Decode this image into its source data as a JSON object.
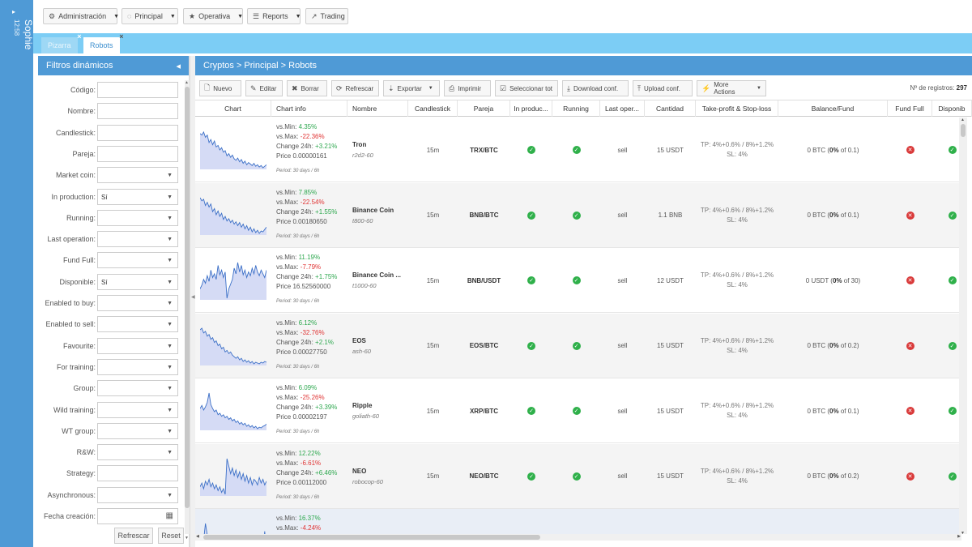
{
  "user": {
    "name": "Sophie",
    "time": "12:58",
    "arrow": "▸"
  },
  "topmenu": [
    {
      "icon": "⚙",
      "label": "Administración",
      "caret": true
    },
    {
      "icon": "◌",
      "label": "Principal",
      "caret": true
    },
    {
      "icon": "★",
      "label": "Operativa",
      "caret": true
    },
    {
      "icon": "☰",
      "label": "Reports",
      "caret": true
    },
    {
      "icon": "↗",
      "label": "Trading",
      "caret": false
    }
  ],
  "tabs": [
    {
      "label": "Pizarra",
      "active": false
    },
    {
      "label": "Robots",
      "active": true
    }
  ],
  "filters": {
    "title": "Filtros dinámicos",
    "collapse": "◂",
    "fields": [
      {
        "label": "Código:",
        "type": "text",
        "value": ""
      },
      {
        "label": "Nombre:",
        "type": "text",
        "value": ""
      },
      {
        "label": "Candlestick:",
        "type": "text",
        "value": ""
      },
      {
        "label": "Pareja:",
        "type": "text",
        "value": ""
      },
      {
        "label": "Market coin:",
        "type": "select",
        "value": ""
      },
      {
        "label": "In production:",
        "type": "select",
        "value": "Sí"
      },
      {
        "label": "Running:",
        "type": "select",
        "value": ""
      },
      {
        "label": "Last operation:",
        "type": "select",
        "value": ""
      },
      {
        "label": "Fund Full:",
        "type": "select",
        "value": ""
      },
      {
        "label": "Disponible:",
        "type": "select",
        "value": "Sí"
      },
      {
        "label": "Enabled to buy:",
        "type": "select",
        "value": ""
      },
      {
        "label": "Enabled to sell:",
        "type": "select",
        "value": ""
      },
      {
        "label": "Favourite:",
        "type": "select",
        "value": ""
      },
      {
        "label": "For training:",
        "type": "select",
        "value": ""
      },
      {
        "label": "Group:",
        "type": "select",
        "value": ""
      },
      {
        "label": "Wild training:",
        "type": "select",
        "value": ""
      },
      {
        "label": "WT group:",
        "type": "select",
        "value": ""
      },
      {
        "label": "R&W:",
        "type": "select",
        "value": ""
      },
      {
        "label": "Strategy:",
        "type": "text",
        "value": ""
      },
      {
        "label": "Asynchronous:",
        "type": "select",
        "value": ""
      },
      {
        "label": "Fecha creación:",
        "type": "date",
        "value": ""
      }
    ],
    "refresh_label": "Refrescar",
    "reset_label": "Reset"
  },
  "main": {
    "breadcrumb": "Cryptos > Principal > Robots",
    "toolbar": [
      {
        "icon": "🗋",
        "label": "Nuevo",
        "caret": false
      },
      {
        "icon": "✎",
        "label": "Editar",
        "caret": false
      },
      {
        "icon": "✖",
        "label": "Borrar",
        "caret": false
      },
      {
        "icon": "⟳",
        "label": "Refrescar",
        "caret": false
      },
      {
        "icon": "⇣",
        "label": "Exportar",
        "caret": true
      },
      {
        "icon": "⎙",
        "label": "Imprimir",
        "caret": false
      },
      {
        "icon": "☑",
        "label": "Seleccionar tot",
        "caret": false
      },
      {
        "icon": "⤓",
        "label": "Download conf.",
        "caret": false
      },
      {
        "icon": "⤒",
        "label": "Upload conf.",
        "caret": false
      },
      {
        "icon": "⚡",
        "label": "More Actions",
        "caret": true
      }
    ],
    "records_label": "Nº de registros:",
    "records_count": "297",
    "columns": [
      "Chart",
      "Chart info",
      "Nombre",
      "Candlestick",
      "Pareja",
      "In produc...",
      "Running",
      "Last oper...",
      "Cantidad",
      "Take-profit & Stop-loss",
      "Balance/Fund",
      "Fund Full",
      "Disponib"
    ]
  },
  "rows": [
    {
      "vsmin": "4.35%",
      "vsmax": "-22.36%",
      "change": "+3.21%",
      "price": "Price 0.00000161",
      "period": "Period: 30 days / 6h",
      "name": "Tron",
      "code": "r2d2-60",
      "candle": "15m",
      "pair": "TRX/BTC",
      "inprod": true,
      "running": true,
      "last": "sell",
      "qty": "15 USDT",
      "tp": "TP: 4%+0.6% / 8%+1.2%",
      "sl": "SL: 4%",
      "bal_pre": "0 BTC (",
      "bal_pct": "0%",
      "bal_post": " of 0.1)",
      "fundfull": false,
      "disp": true,
      "spark": [
        60,
        58,
        62,
        55,
        58,
        48,
        52,
        45,
        50,
        42,
        44,
        38,
        41,
        35,
        37,
        30,
        33,
        28,
        31,
        26,
        24,
        27,
        22,
        25,
        20,
        23,
        18,
        21,
        19,
        17,
        20,
        16,
        18,
        15,
        17,
        14,
        16,
        18
      ]
    },
    {
      "vsmin": "7.85%",
      "vsmax": "-22.54%",
      "change": "+1.55%",
      "price": "Price 0.00180650",
      "period": "Period: 30 days / 6h",
      "name": "Binance Coin",
      "code": "t800-60",
      "candle": "15m",
      "pair": "BNB/BTC",
      "inprod": true,
      "running": true,
      "last": "sell",
      "qty": "1.1 BNB",
      "tp": "TP: 4%+0.6% / 8%+1.2%",
      "sl": "SL: 4%",
      "bal_pre": "0 BTC (",
      "bal_pct": "0%",
      "bal_post": " of 0.1)",
      "fundfull": false,
      "disp": true,
      "spark": [
        62,
        58,
        60,
        52,
        56,
        50,
        54,
        44,
        48,
        40,
        45,
        38,
        42,
        34,
        38,
        32,
        35,
        30,
        33,
        28,
        31,
        26,
        30,
        24,
        28,
        22,
        26,
        20,
        24,
        18,
        22,
        17,
        20,
        16,
        19,
        18,
        21,
        24
      ]
    },
    {
      "vsmin": "11.19%",
      "vsmax": "-7.79%",
      "change": "+1.75%",
      "price": "Price 16.52560000",
      "period": "Period: 30 days / 6h",
      "name": "Binance Coin ...",
      "code": "t1000-60",
      "candle": "15m",
      "pair": "BNB/USDT",
      "inprod": true,
      "running": true,
      "last": "sell",
      "qty": "12 USDT",
      "tp": "TP: 4%+0.6% / 8%+1.2%",
      "sl": "SL: 4%",
      "bal_pre": "0 USDT (",
      "bal_pct": "0%",
      "bal_post": " of 30)",
      "fundfull": false,
      "disp": true,
      "spark": [
        30,
        34,
        40,
        36,
        44,
        38,
        50,
        42,
        46,
        40,
        55,
        45,
        50,
        42,
        48,
        20,
        30,
        35,
        40,
        52,
        46,
        58,
        48,
        55,
        45,
        50,
        42,
        48,
        44,
        52,
        46,
        55,
        48,
        44,
        50,
        46,
        42,
        50
      ]
    },
    {
      "vsmin": "6.12%",
      "vsmax": "-32.76%",
      "change": "+2.1%",
      "price": "Price 0.00027750",
      "period": "Period: 30 days / 6h",
      "name": "EOS",
      "code": "ash-60",
      "candle": "15m",
      "pair": "EOS/BTC",
      "inprod": true,
      "running": true,
      "last": "sell",
      "qty": "15 USDT",
      "tp": "TP: 4%+0.6% / 8%+1.2%",
      "sl": "SL: 4%",
      "bal_pre": "0 BTC (",
      "bal_pct": "0%",
      "bal_post": " of 0.2)",
      "fundfull": false,
      "disp": true,
      "spark": [
        58,
        60,
        54,
        56,
        50,
        52,
        46,
        48,
        42,
        44,
        38,
        40,
        34,
        36,
        30,
        32,
        28,
        30,
        26,
        24,
        22,
        24,
        20,
        22,
        18,
        20,
        17,
        19,
        16,
        18,
        15,
        17,
        16,
        15,
        17,
        16,
        18,
        17
      ]
    },
    {
      "vsmin": "6.09%",
      "vsmax": "-25.26%",
      "change": "+3.39%",
      "price": "Price 0.00002197",
      "period": "Period: 30 days / 6h",
      "name": "Ripple",
      "code": "goliath-60",
      "candle": "15m",
      "pair": "XRP/BTC",
      "inprod": true,
      "running": true,
      "last": "sell",
      "qty": "15 USDT",
      "tp": "TP: 4%+0.6% / 8%+1.2%",
      "sl": "SL: 4%",
      "bal_pre": "0 BTC (",
      "bal_pct": "0%",
      "bal_post": " of 0.1)",
      "fundfull": false,
      "disp": true,
      "spark": [
        40,
        44,
        38,
        42,
        48,
        60,
        45,
        40,
        36,
        38,
        32,
        34,
        30,
        32,
        28,
        30,
        26,
        28,
        24,
        26,
        22,
        24,
        20,
        22,
        19,
        21,
        17,
        19,
        16,
        18,
        15,
        17,
        14,
        16,
        15,
        17,
        18,
        20
      ]
    },
    {
      "vsmin": "12.22%",
      "vsmax": "-6.61%",
      "change": "+6.46%",
      "price": "Price 0.00112000",
      "period": "Period: 30 days / 6h",
      "name": "NEO",
      "code": "robocop-60",
      "candle": "15m",
      "pair": "NEO/BTC",
      "inprod": true,
      "running": true,
      "last": "sell",
      "qty": "15 USDT",
      "tp": "TP: 4%+0.6% / 8%+1.2%",
      "sl": "SL: 4%",
      "bal_pre": "0 BTC (",
      "bal_pct": "0%",
      "bal_post": " of 0.2)",
      "fundfull": false,
      "disp": true,
      "spark": [
        28,
        32,
        26,
        34,
        30,
        36,
        28,
        32,
        26,
        30,
        24,
        28,
        22,
        26,
        20,
        58,
        50,
        42,
        48,
        40,
        46,
        38,
        44,
        36,
        42,
        34,
        40,
        32,
        38,
        30,
        36,
        34,
        30,
        38,
        32,
        36,
        30,
        34
      ]
    },
    {
      "vsmin": "16.37%",
      "vsmax": "-4.24%",
      "change": "",
      "price": "",
      "period": "",
      "name": "",
      "code": "",
      "candle": "",
      "pair": "",
      "inprod": null,
      "running": null,
      "last": "",
      "qty": "",
      "tp": "",
      "sl": "",
      "bal_pre": "",
      "bal_pct": "",
      "bal_post": "",
      "fundfull": null,
      "disp": null,
      "spark": [
        40,
        44,
        38,
        60,
        45,
        40,
        36,
        38,
        32,
        34,
        30,
        32,
        28,
        30,
        26,
        28,
        24,
        26,
        22,
        24,
        20,
        22,
        19,
        21,
        17,
        19,
        16,
        18,
        15,
        17,
        14,
        16,
        15,
        17,
        18,
        20,
        50,
        22
      ]
    }
  ],
  "labels": {
    "vsmin": "vs.Min: ",
    "vsmax": "vs.Max: ",
    "change": "Change 24h: "
  },
  "colors": {
    "accent": "#4f9ad6",
    "tabbar": "#7ccdf5",
    "positive": "#2ea84f",
    "negative": "#e03434",
    "spark_fill": "#d5dbf5",
    "spark_line": "#3b6fc7"
  }
}
